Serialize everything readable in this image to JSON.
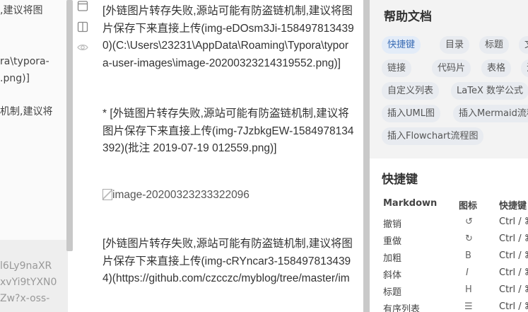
{
  "left_preview": {
    "lines": [
      {
        "text": ",建议将图"
      },
      {
        "text": "ra\\typora-"
      },
      {
        "text": ".png)]"
      },
      {
        "text": "机制,建议将"
      }
    ],
    "gray_lines": [
      {
        "text": "l6Ly9naXR"
      },
      {
        "text": "xvYi9tYXN0"
      },
      {
        "text": "Zw?x-oss-"
      }
    ]
  },
  "toolbar": {
    "icons": [
      "outline-icon",
      "split-view-icon",
      "eye-icon"
    ]
  },
  "editor": {
    "paragraphs": [
      {
        "text": "[外链图片转存失败,源站可能有防盗链机制,建议将图片保存下来直接上传(img-eDOsm3Ji-1584978134390)(C:\\Users\\23231\\AppData\\Roaming\\Typora\\typora-user-images\\image-20200323214319552.png)]"
      },
      {
        "text": "* [外链图片转存失败,源站可能有防盗链机制,建议将图片保存下来直接上传(img-7JzbkgEW-1584978134392)(批注 2019-07-19 012559.png)]"
      },
      {
        "text": "[外链图片转存失败,源站可能有防盗链机制,建议将图片保存下来直接上传(img-cRYncar3-1584978134394)(https://github.com/czcczc/myblog/tree/master/im"
      }
    ],
    "broken_image_alt": "image-20200323233322096"
  },
  "help": {
    "title": "帮助文档",
    "tags": [
      {
        "label": "快捷键",
        "active": true
      },
      {
        "label": "目录"
      },
      {
        "label": "标题"
      },
      {
        "label": "文本"
      },
      {
        "label": "链接"
      },
      {
        "label": "代码片"
      },
      {
        "label": "表格"
      },
      {
        "label": "注脚"
      },
      {
        "label": "自定义列表"
      },
      {
        "label": "LaTeX 数学公式"
      },
      {
        "label": "插入UML图"
      },
      {
        "label": "插入Mermaid流程图"
      },
      {
        "label": "插入Flowchart流程图"
      }
    ],
    "shortcuts": {
      "title": "快捷键",
      "headers": {
        "markdown": "Markdown",
        "icon": "图标",
        "key": "快捷键"
      },
      "rows": [
        {
          "name": "撤销",
          "icon": "↺",
          "key": "Ctrl / ⌘ + Z"
        },
        {
          "name": "重做",
          "icon": "↻",
          "key": "Ctrl / ⌘ + Y"
        },
        {
          "name": "加粗",
          "icon": "B",
          "key": "Ctrl / ⌘ + B"
        },
        {
          "name": "斜体",
          "icon": "I",
          "key": "Ctrl / ⌘ + I"
        },
        {
          "name": "标题",
          "icon": "H",
          "key": "Ctrl / ⌘ + Shift + H"
        },
        {
          "name": "有序列表",
          "icon": "☰",
          "key": "Ctrl / ⌘ + Shift + O"
        }
      ]
    }
  }
}
